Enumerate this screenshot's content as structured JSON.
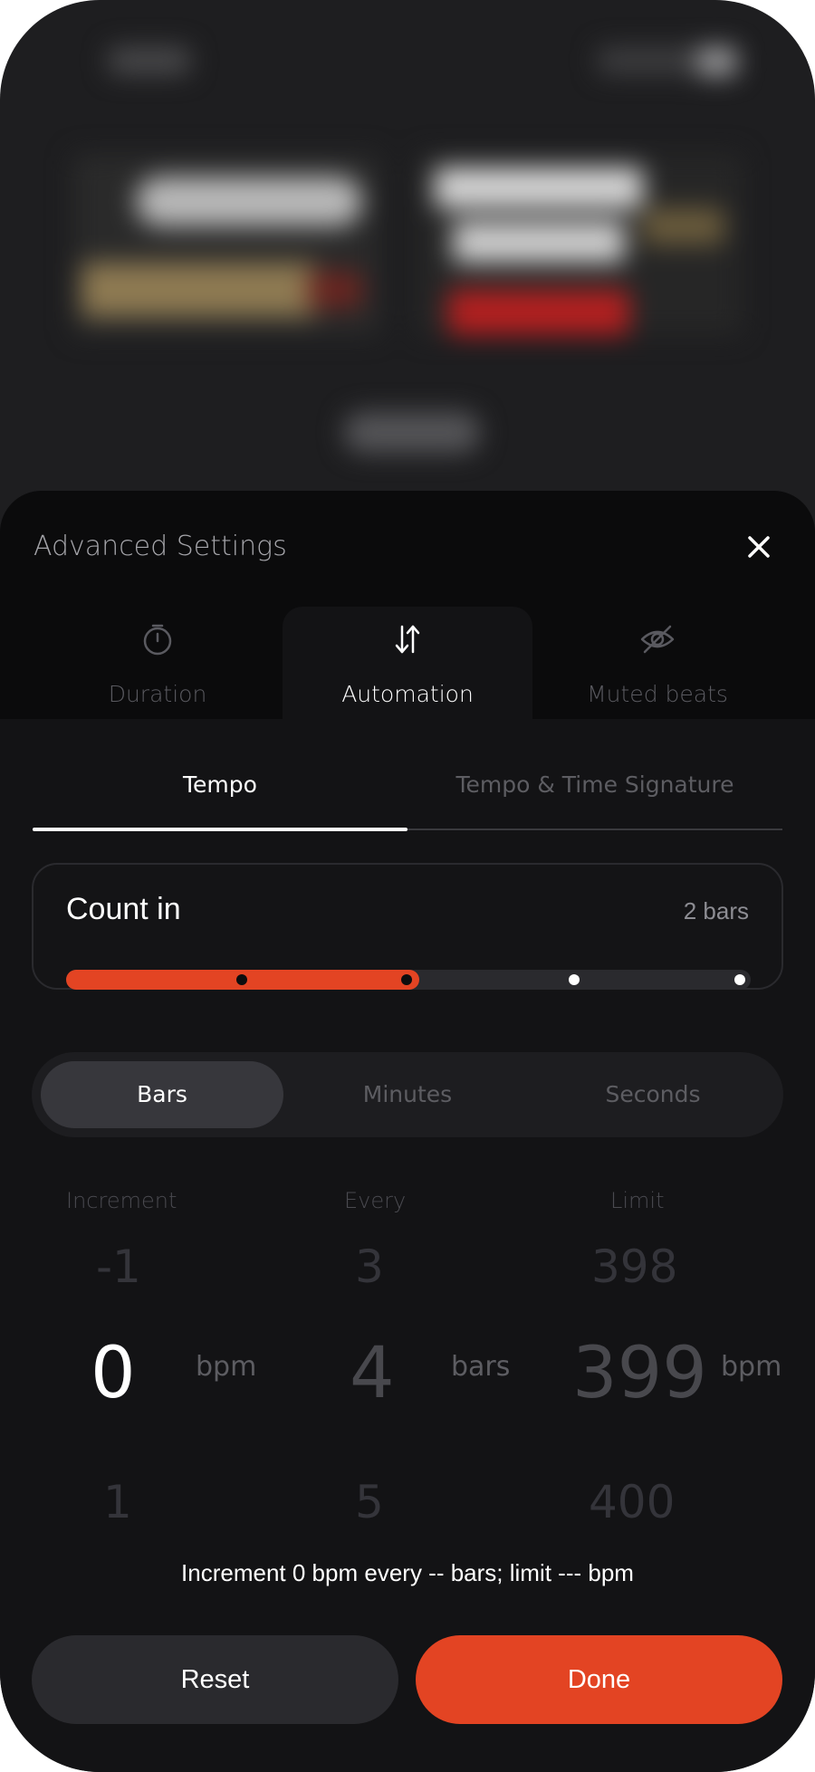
{
  "sheet": {
    "title": "Advanced Settings"
  },
  "tabs": [
    {
      "label": "Duration",
      "icon": "stopwatch-icon"
    },
    {
      "label": "Automation",
      "icon": "swap-vertical-icon"
    },
    {
      "label": "Muted beats",
      "icon": "eye-off-icon"
    }
  ],
  "subtabs": [
    {
      "label": "Tempo"
    },
    {
      "label": "Tempo & Time Signature"
    }
  ],
  "count_in": {
    "title": "Count in",
    "value": "2 bars",
    "level_fraction": 0.5,
    "accent": "#e34423"
  },
  "units": [
    {
      "label": "Bars"
    },
    {
      "label": "Minutes"
    },
    {
      "label": "Seconds"
    }
  ],
  "picker": {
    "increment": {
      "label": "Increment",
      "above": "-1",
      "value": "0",
      "below": "1",
      "unit": "bpm"
    },
    "every": {
      "label": "Every",
      "above": "3",
      "value": "4",
      "below": "5",
      "unit": "bars"
    },
    "limit": {
      "label": "Limit",
      "above": "398",
      "value": "399",
      "below": "400",
      "unit": "bpm"
    }
  },
  "summary": "Increment 0 bpm every -- bars; limit --- bpm",
  "buttons": {
    "reset": "Reset",
    "done": "Done"
  }
}
